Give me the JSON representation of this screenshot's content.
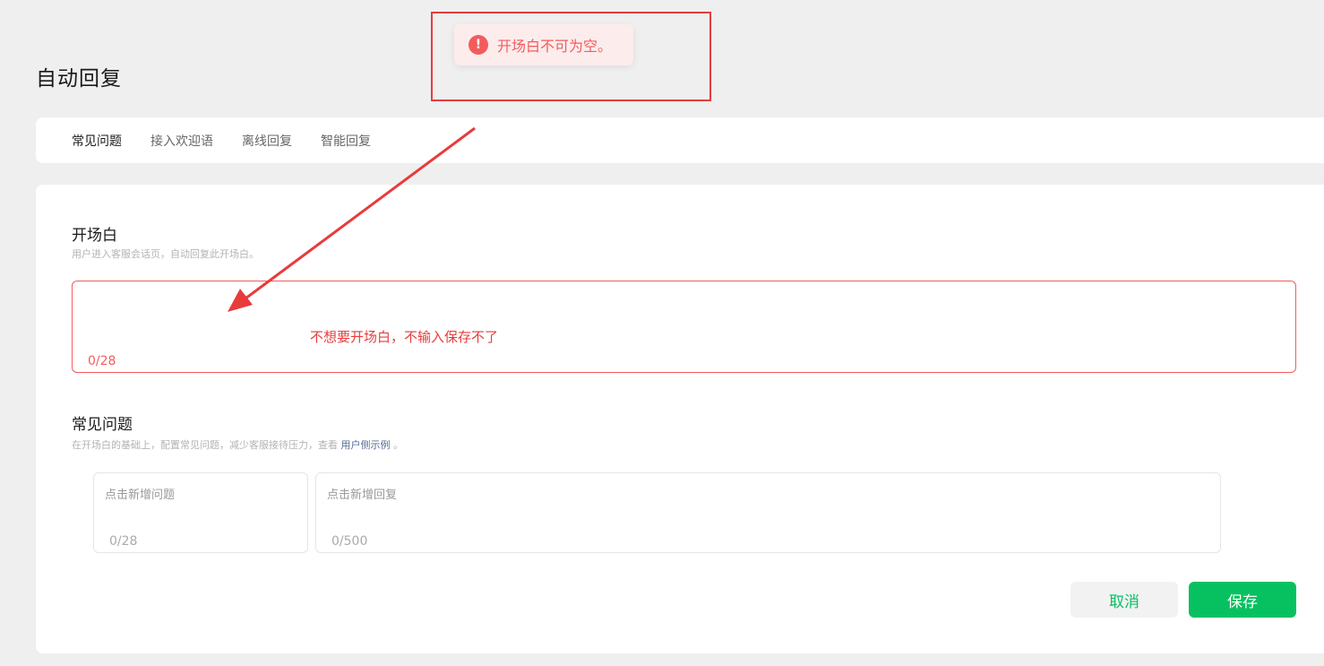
{
  "page": {
    "title": "自动回复"
  },
  "toast": {
    "icon": "exclamation-icon",
    "icon_glyph": "!",
    "message": "开场白不可为空。",
    "color": "#f25c5c"
  },
  "tabs": [
    {
      "label": "常见问题",
      "active": true
    },
    {
      "label": "接入欢迎语",
      "active": false
    },
    {
      "label": "离线回复",
      "active": false
    },
    {
      "label": "智能回复",
      "active": false
    }
  ],
  "opening": {
    "title": "开场白",
    "description": "用户进入客服会话页，自动回复此开场白。",
    "value": "",
    "counter": "0/28",
    "annotation": "不想要开场白，不输入保存不了"
  },
  "faq": {
    "title": "常见问题",
    "description_prefix": "在开场白的基础上，配置常见问题，减少客服接待压力，查看",
    "description_link": "用户侧示例",
    "description_suffix": "。",
    "question_placeholder": "点击新增问题",
    "question_counter": "0/28",
    "reply_placeholder": "点击新增回复",
    "reply_counter": "0/500"
  },
  "actions": {
    "cancel_label": "取消",
    "save_label": "保存"
  },
  "colors": {
    "accent": "#07c160",
    "error": "#f25c5c",
    "annotation": "#e83b3b"
  }
}
